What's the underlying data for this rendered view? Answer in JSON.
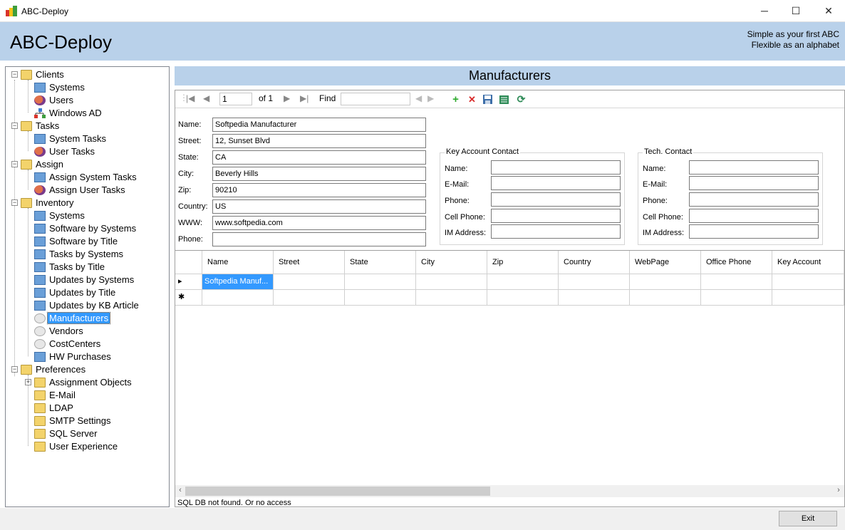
{
  "window": {
    "title": "ABC-Deploy",
    "controls": {
      "minimize": "─",
      "maximize": "☐",
      "close": "✕"
    }
  },
  "header": {
    "heading": "ABC-Deploy",
    "tagline_line1": "Simple as your first ABC",
    "tagline_line2": "Flexible as an alphabet"
  },
  "tree": {
    "clients": "Clients",
    "clients_systems": "Systems",
    "clients_users": "Users",
    "clients_windows_ad": "Windows AD",
    "tasks": "Tasks",
    "tasks_system": "System Tasks",
    "tasks_user": "User Tasks",
    "assign": "Assign",
    "assign_system": "Assign System Tasks",
    "assign_user": "Assign User Tasks",
    "inventory": "Inventory",
    "inv_systems": "Systems",
    "inv_sw_systems": "Software by Systems",
    "inv_sw_title": "Software by Title",
    "inv_tasks_systems": "Tasks by Systems",
    "inv_tasks_title": "Tasks by Title",
    "inv_upd_systems": "Updates by Systems",
    "inv_upd_title": "Updates by Title",
    "inv_upd_kb": "Updates by KB Article",
    "inv_manufacturers": "Manufacturers",
    "inv_vendors": "Vendors",
    "inv_costcenters": "CostCenters",
    "inv_hw_purchases": "HW Purchases",
    "preferences": "Preferences",
    "pref_assignment": "Assignment Objects",
    "pref_email": "E-Mail",
    "pref_ldap": "LDAP",
    "pref_smtp": "SMTP Settings",
    "pref_sql": "SQL Server",
    "pref_ux": "User Experience"
  },
  "section": {
    "title": "Manufacturers"
  },
  "toolbar": {
    "position": "1",
    "of_count": "of 1",
    "find": "Find",
    "find_value": ""
  },
  "form": {
    "name_label": "Name:",
    "name_value": "Softpedia Manufacturer",
    "street_label": "Street:",
    "street_value": "12, Sunset Blvd",
    "state_label": "State:",
    "state_value": "CA",
    "city_label": "City:",
    "city_value": "Beverly Hills",
    "zip_label": "Zip:",
    "zip_value": "90210",
    "country_label": "Country:",
    "country_value": "US",
    "www_label": "WWW:",
    "www_value": "www.softpedia.com",
    "phone_label": "Phone:",
    "phone_value": ""
  },
  "key_account": {
    "title": "Key Account Contact",
    "name_label": "Name:",
    "name_value": "",
    "email_label": "E-Mail:",
    "email_value": "",
    "phone_label": "Phone:",
    "phone_value": "",
    "cell_label": "Cell Phone:",
    "cell_value": "",
    "im_label": "IM Address:",
    "im_value": ""
  },
  "tech_contact": {
    "title": "Tech. Contact",
    "name_label": "Name:",
    "name_value": "",
    "email_label": "E-Mail:",
    "email_value": "",
    "phone_label": "Phone:",
    "phone_value": "",
    "cell_label": "Cell Phone:",
    "cell_value": "",
    "im_label": "IM Address:",
    "im_value": ""
  },
  "grid": {
    "columns": [
      "Name",
      "Street",
      "State",
      "City",
      "Zip",
      "Country",
      "WebPage",
      "Office Phone",
      "Key Account"
    ],
    "row1_marker": "▸",
    "row1_name": "Softpedia Manuf...",
    "new_row_marker": "✱"
  },
  "status": "SQL DB not found. Or no access",
  "exit_button": "Exit"
}
